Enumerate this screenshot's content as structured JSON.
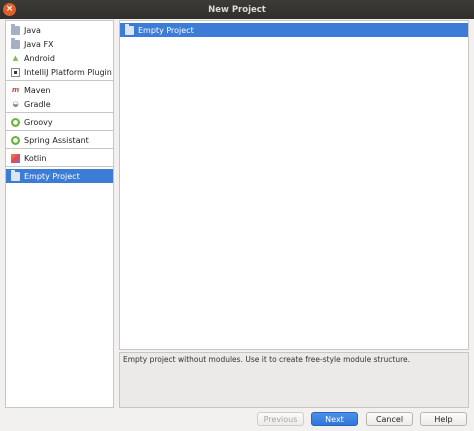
{
  "window": {
    "title": "New Project",
    "close_glyph": "×"
  },
  "sidebar": {
    "groups": [
      [
        {
          "label": "Java",
          "icon": "folder-icon"
        },
        {
          "label": "Java FX",
          "icon": "folder-icon"
        },
        {
          "label": "Android",
          "icon": "android-icon"
        },
        {
          "label": "IntelliJ Platform Plugin",
          "icon": "intellij-icon"
        }
      ],
      [
        {
          "label": "Maven",
          "icon": "maven-icon"
        },
        {
          "label": "Gradle",
          "icon": "gradle-icon"
        }
      ],
      [
        {
          "label": "Groovy",
          "icon": "groovy-icon"
        }
      ],
      [
        {
          "label": "Spring Assistant",
          "icon": "spring-icon"
        }
      ],
      [
        {
          "label": "Kotlin",
          "icon": "kotlin-icon"
        }
      ],
      [
        {
          "label": "Empty Project",
          "icon": "folder-icon",
          "selected": true
        }
      ]
    ]
  },
  "templates": {
    "items": [
      {
        "label": "Empty Project",
        "selected": true
      }
    ]
  },
  "description": "Empty project without modules. Use it to create free-style module structure.",
  "buttons": {
    "previous": "Previous",
    "next": "Next",
    "cancel": "Cancel",
    "help": "Help"
  },
  "colors": {
    "selection": "#3c7bd6",
    "primary_button": "#2f76d9"
  }
}
